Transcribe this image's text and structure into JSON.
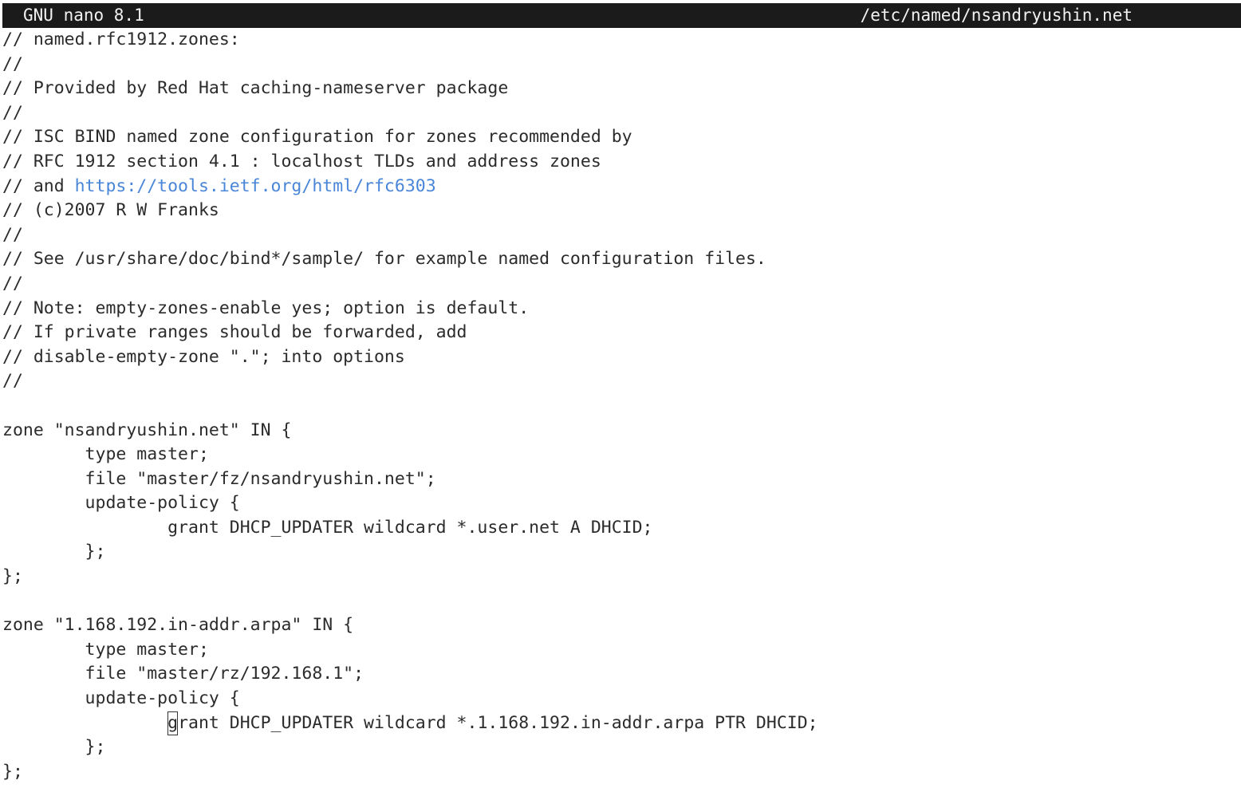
{
  "titlebar": {
    "app": "GNU nano 8.1",
    "file": "/etc/named/nsandryushin.net"
  },
  "lines": {
    "l1": "// named.rfc1912.zones:",
    "l2": "//",
    "l3": "// Provided by Red Hat caching-nameserver package",
    "l4": "//",
    "l5": "// ISC BIND named zone configuration for zones recommended by",
    "l6": "// RFC 1912 section 4.1 : localhost TLDs and address zones",
    "l7_prefix": "// and ",
    "l7_url": "https://tools.ietf.org/html/rfc6303",
    "l8": "// (c)2007 R W Franks",
    "l9": "//",
    "l10": "// See /usr/share/doc/bind*/sample/ for example named configuration files.",
    "l11": "//",
    "l12": "// Note: empty-zones-enable yes; option is default.",
    "l13": "// If private ranges should be forwarded, add",
    "l14": "// disable-empty-zone \".\"; into options",
    "l15": "//",
    "l16": "",
    "l17": "zone \"nsandryushin.net\" IN {",
    "l18": "        type master;",
    "l19": "        file \"master/fz/nsandryushin.net\";",
    "l20": "        update-policy {",
    "l21": "                grant DHCP_UPDATER wildcard *.user.net A DHCID;",
    "l22": "        };",
    "l23": "};",
    "l24": "",
    "l25": "zone \"1.168.192.in-addr.arpa\" IN {",
    "l26": "        type master;",
    "l27": "        file \"master/rz/192.168.1\";",
    "l28": "        update-policy {",
    "l29_indent": "                ",
    "l29_cursor": "g",
    "l29_rest": "rant DHCP_UPDATER wildcard *.1.168.192.in-addr.arpa PTR DHCID;",
    "l30": "        };",
    "l31": "};"
  },
  "colors": {
    "titlebar_bg": "#1b1b1b",
    "titlebar_fg": "#f2f2f2",
    "text": "#2b2b2b",
    "link": "#4a86d8"
  }
}
